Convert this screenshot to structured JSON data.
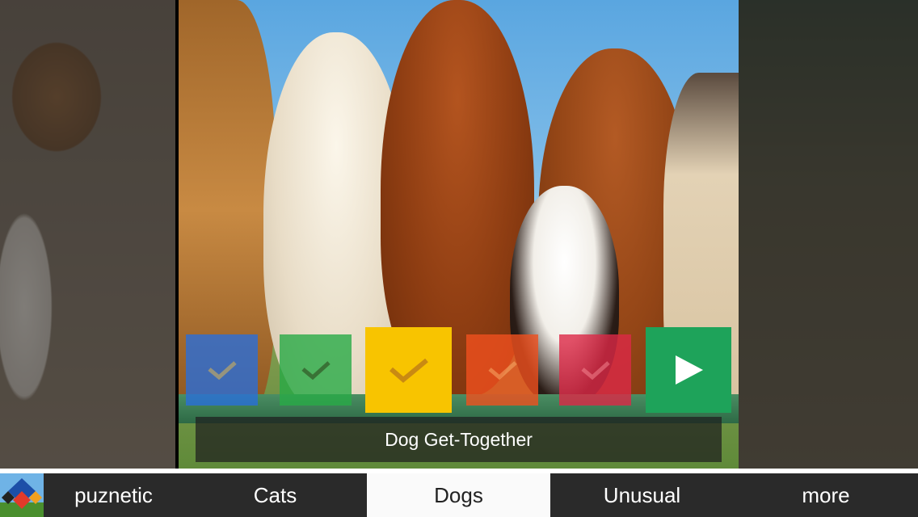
{
  "puzzle": {
    "caption": "Dog Get-Together",
    "tiles": [
      {
        "name": "blue",
        "color": "#286edc",
        "state": "check"
      },
      {
        "name": "green",
        "color": "#28aa46",
        "state": "check"
      },
      {
        "name": "yellow",
        "color": "#f8c400",
        "state": "check",
        "selected": true
      },
      {
        "name": "orange",
        "color": "#f0501e",
        "state": "check"
      },
      {
        "name": "red",
        "color": "#dc2846",
        "state": "check"
      }
    ],
    "play_icon": "play-icon",
    "play_color": "#1ea35a"
  },
  "tabbar": {
    "brand_label": "puznetic",
    "brand_icon": "puznetic-logo-icon",
    "tabs": [
      {
        "label": "Cats",
        "selected": false
      },
      {
        "label": "Dogs",
        "selected": true
      },
      {
        "label": "Unusual",
        "selected": false
      },
      {
        "label": "more",
        "selected": false
      }
    ]
  }
}
